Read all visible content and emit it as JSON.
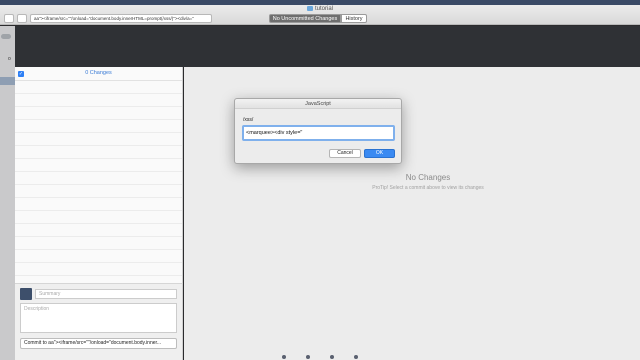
{
  "window": {
    "title": "tutorial"
  },
  "toolbar": {
    "branch_value": "aa\"><iframe/src=\"\"/onload=\"document.body.innerHTML=prompt(/xss/)\"><div/a=\"",
    "branch_chevron": "⌄",
    "tab_changes": "No Uncommitted Changes",
    "tab_history": "History"
  },
  "sidebar_strip": {
    "letter": "o"
  },
  "changes_list": {
    "count_label": "0 Changes",
    "checkbox_glyph": "✓"
  },
  "commit": {
    "summary_placeholder": "Summary",
    "description_placeholder": "Description",
    "button_label": "Commit to aa\"><iframe/src=\"\"/onload=\"document.body.inner..."
  },
  "main": {
    "empty_title": "No Changes",
    "empty_tip": "ProTip! Select a commit above to view its changes"
  },
  "dialog": {
    "title": "JavaScript",
    "prompt": "/xss/",
    "input_value": "<marquee><div style=\"",
    "cancel_label": "Cancel",
    "ok_label": "OK"
  },
  "colors": {
    "accent": "#2d7ff5",
    "dark_band": "#2f3135",
    "ok_button": "#3a8af2"
  }
}
